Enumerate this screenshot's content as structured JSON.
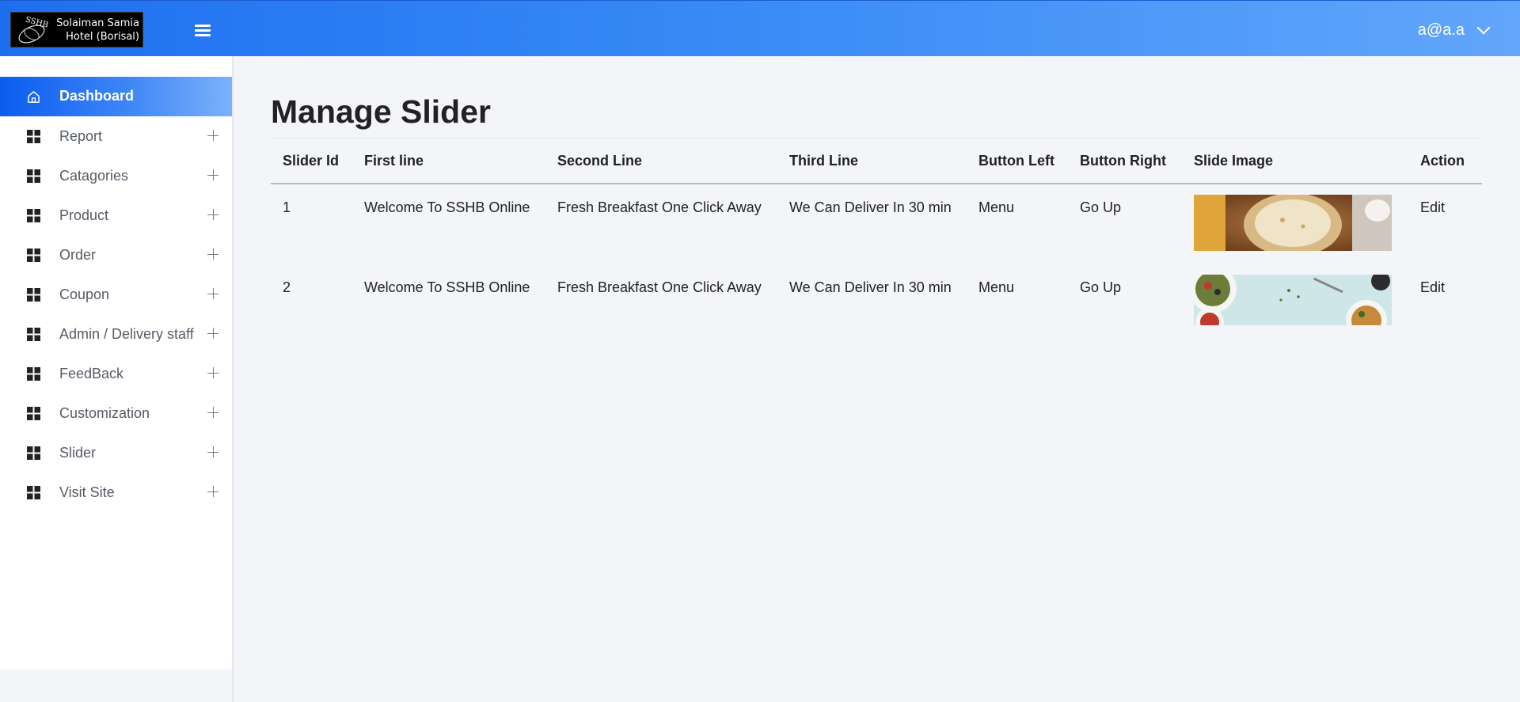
{
  "header": {
    "logo_text_line1": "Solaiman Samia",
    "logo_text_line2": "Hotel (Borisal)",
    "logo_mark": "SSHB",
    "user": "a@a.a",
    "menu_icon": "hamburger-icon",
    "accent_start": "#1e6ff0",
    "accent_end": "#62a6fb"
  },
  "sidebar": {
    "items": [
      {
        "label": "Dashboard",
        "icon": "home-icon",
        "active": true
      },
      {
        "label": "Report",
        "icon": "grid-icon"
      },
      {
        "label": "Catagories",
        "icon": "grid-icon"
      },
      {
        "label": "Product",
        "icon": "grid-icon"
      },
      {
        "label": "Order",
        "icon": "grid-icon"
      },
      {
        "label": "Coupon",
        "icon": "grid-icon"
      },
      {
        "label": "Admin / Delivery staff",
        "icon": "grid-icon"
      },
      {
        "label": "FeedBack",
        "icon": "grid-icon"
      },
      {
        "label": "Customization",
        "icon": "grid-icon"
      },
      {
        "label": "Slider",
        "icon": "grid-icon"
      },
      {
        "label": "Visit Site",
        "icon": "grid-icon"
      }
    ]
  },
  "main": {
    "title": "Manage Slider",
    "table": {
      "headers": [
        "Slider Id",
        "First line",
        "Second Line",
        "Third Line",
        "Button Left",
        "Button Right",
        "Slide Image",
        "Action"
      ],
      "rows": [
        {
          "id": "1",
          "first": "Welcome To SSHB Online",
          "second": "Fresh Breakfast One Click Away",
          "third": "We Can Deliver In 30 min",
          "button_left": "Menu",
          "button_right": "Go Up",
          "image": "flatbread-basket-photo",
          "action": "Edit"
        },
        {
          "id": "2",
          "first": "Welcome To SSHB Online",
          "second": "Fresh Breakfast One Click Away",
          "third": "We Can Deliver In 30 min",
          "button_left": "Menu",
          "button_right": "Go Up",
          "image": "salad-bowls-photo",
          "action": "Edit"
        }
      ]
    }
  }
}
